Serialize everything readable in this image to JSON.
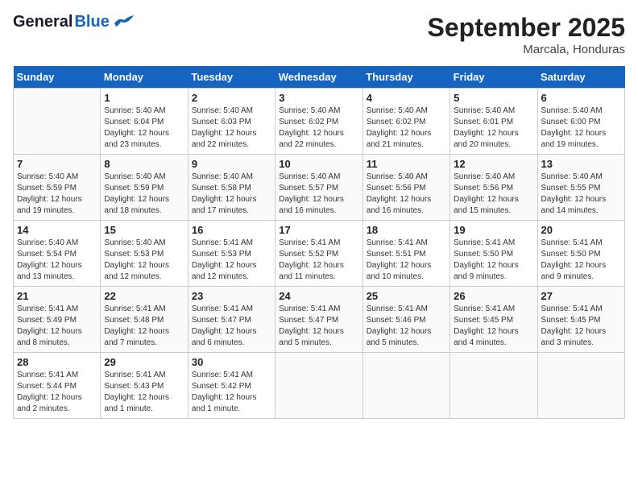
{
  "header": {
    "logo_general": "General",
    "logo_blue": "Blue",
    "month": "September 2025",
    "location": "Marcala, Honduras"
  },
  "days_of_week": [
    "Sunday",
    "Monday",
    "Tuesday",
    "Wednesday",
    "Thursday",
    "Friday",
    "Saturday"
  ],
  "weeks": [
    [
      {
        "day": "",
        "info": ""
      },
      {
        "day": "1",
        "info": "Sunrise: 5:40 AM\nSunset: 6:04 PM\nDaylight: 12 hours\nand 23 minutes."
      },
      {
        "day": "2",
        "info": "Sunrise: 5:40 AM\nSunset: 6:03 PM\nDaylight: 12 hours\nand 22 minutes."
      },
      {
        "day": "3",
        "info": "Sunrise: 5:40 AM\nSunset: 6:02 PM\nDaylight: 12 hours\nand 22 minutes."
      },
      {
        "day": "4",
        "info": "Sunrise: 5:40 AM\nSunset: 6:02 PM\nDaylight: 12 hours\nand 21 minutes."
      },
      {
        "day": "5",
        "info": "Sunrise: 5:40 AM\nSunset: 6:01 PM\nDaylight: 12 hours\nand 20 minutes."
      },
      {
        "day": "6",
        "info": "Sunrise: 5:40 AM\nSunset: 6:00 PM\nDaylight: 12 hours\nand 19 minutes."
      }
    ],
    [
      {
        "day": "7",
        "info": "Sunrise: 5:40 AM\nSunset: 5:59 PM\nDaylight: 12 hours\nand 19 minutes."
      },
      {
        "day": "8",
        "info": "Sunrise: 5:40 AM\nSunset: 5:59 PM\nDaylight: 12 hours\nand 18 minutes."
      },
      {
        "day": "9",
        "info": "Sunrise: 5:40 AM\nSunset: 5:58 PM\nDaylight: 12 hours\nand 17 minutes."
      },
      {
        "day": "10",
        "info": "Sunrise: 5:40 AM\nSunset: 5:57 PM\nDaylight: 12 hours\nand 16 minutes."
      },
      {
        "day": "11",
        "info": "Sunrise: 5:40 AM\nSunset: 5:56 PM\nDaylight: 12 hours\nand 16 minutes."
      },
      {
        "day": "12",
        "info": "Sunrise: 5:40 AM\nSunset: 5:56 PM\nDaylight: 12 hours\nand 15 minutes."
      },
      {
        "day": "13",
        "info": "Sunrise: 5:40 AM\nSunset: 5:55 PM\nDaylight: 12 hours\nand 14 minutes."
      }
    ],
    [
      {
        "day": "14",
        "info": "Sunrise: 5:40 AM\nSunset: 5:54 PM\nDaylight: 12 hours\nand 13 minutes."
      },
      {
        "day": "15",
        "info": "Sunrise: 5:40 AM\nSunset: 5:53 PM\nDaylight: 12 hours\nand 12 minutes."
      },
      {
        "day": "16",
        "info": "Sunrise: 5:41 AM\nSunset: 5:53 PM\nDaylight: 12 hours\nand 12 minutes."
      },
      {
        "day": "17",
        "info": "Sunrise: 5:41 AM\nSunset: 5:52 PM\nDaylight: 12 hours\nand 11 minutes."
      },
      {
        "day": "18",
        "info": "Sunrise: 5:41 AM\nSunset: 5:51 PM\nDaylight: 12 hours\nand 10 minutes."
      },
      {
        "day": "19",
        "info": "Sunrise: 5:41 AM\nSunset: 5:50 PM\nDaylight: 12 hours\nand 9 minutes."
      },
      {
        "day": "20",
        "info": "Sunrise: 5:41 AM\nSunset: 5:50 PM\nDaylight: 12 hours\nand 9 minutes."
      }
    ],
    [
      {
        "day": "21",
        "info": "Sunrise: 5:41 AM\nSunset: 5:49 PM\nDaylight: 12 hours\nand 8 minutes."
      },
      {
        "day": "22",
        "info": "Sunrise: 5:41 AM\nSunset: 5:48 PM\nDaylight: 12 hours\nand 7 minutes."
      },
      {
        "day": "23",
        "info": "Sunrise: 5:41 AM\nSunset: 5:47 PM\nDaylight: 12 hours\nand 6 minutes."
      },
      {
        "day": "24",
        "info": "Sunrise: 5:41 AM\nSunset: 5:47 PM\nDaylight: 12 hours\nand 5 minutes."
      },
      {
        "day": "25",
        "info": "Sunrise: 5:41 AM\nSunset: 5:46 PM\nDaylight: 12 hours\nand 5 minutes."
      },
      {
        "day": "26",
        "info": "Sunrise: 5:41 AM\nSunset: 5:45 PM\nDaylight: 12 hours\nand 4 minutes."
      },
      {
        "day": "27",
        "info": "Sunrise: 5:41 AM\nSunset: 5:45 PM\nDaylight: 12 hours\nand 3 minutes."
      }
    ],
    [
      {
        "day": "28",
        "info": "Sunrise: 5:41 AM\nSunset: 5:44 PM\nDaylight: 12 hours\nand 2 minutes."
      },
      {
        "day": "29",
        "info": "Sunrise: 5:41 AM\nSunset: 5:43 PM\nDaylight: 12 hours\nand 1 minute."
      },
      {
        "day": "30",
        "info": "Sunrise: 5:41 AM\nSunset: 5:42 PM\nDaylight: 12 hours\nand 1 minute."
      },
      {
        "day": "",
        "info": ""
      },
      {
        "day": "",
        "info": ""
      },
      {
        "day": "",
        "info": ""
      },
      {
        "day": "",
        "info": ""
      }
    ]
  ]
}
